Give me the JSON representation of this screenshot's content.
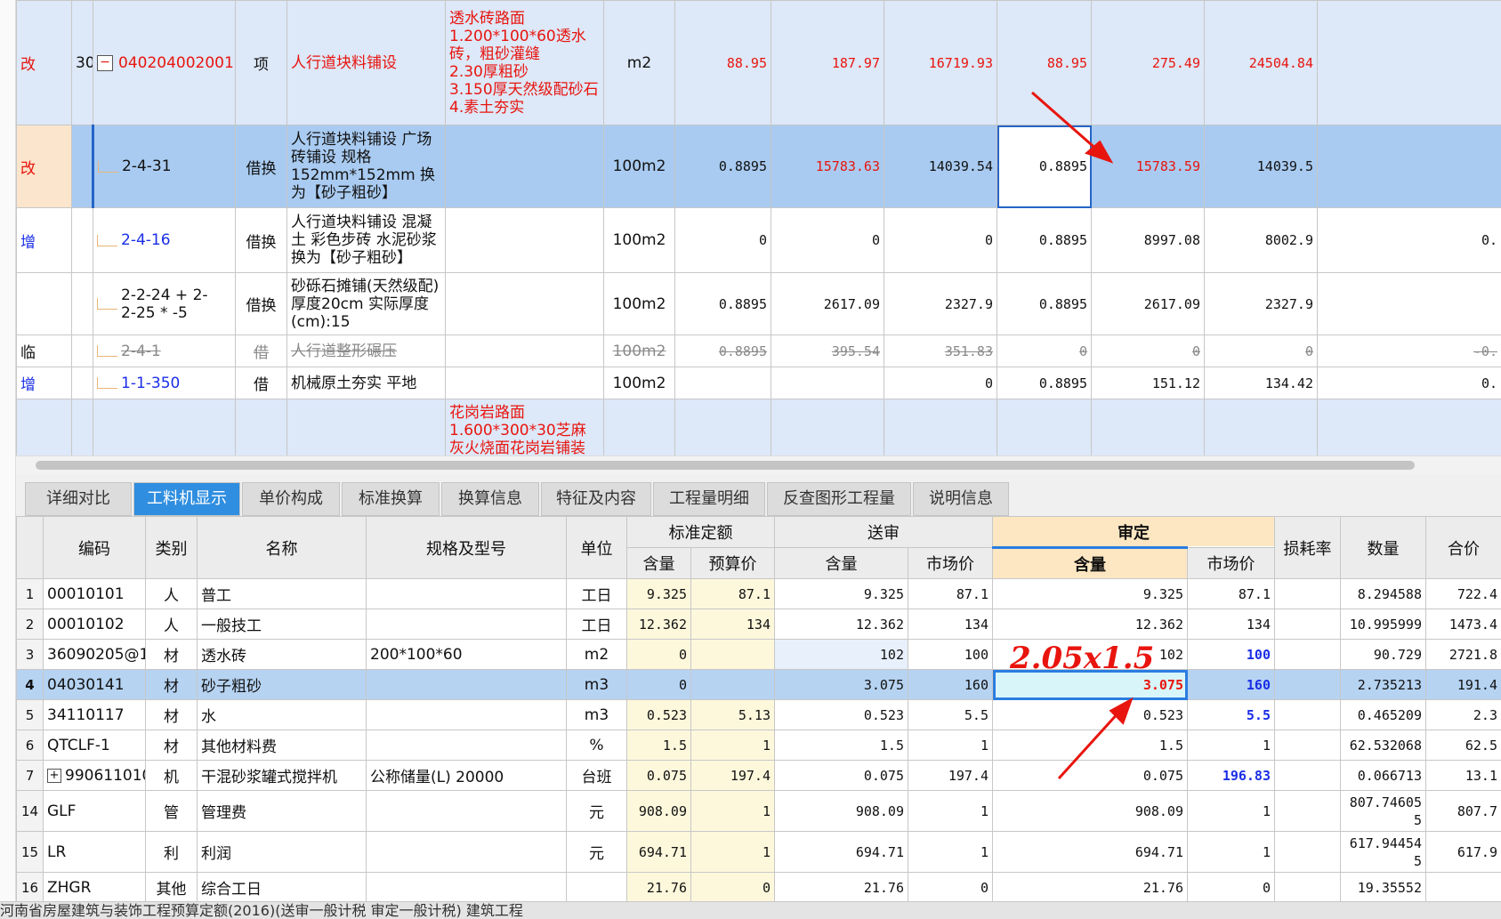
{
  "top_rows": [
    {
      "flag": "改",
      "flag_color": "red",
      "no": "30",
      "code": "040204002001",
      "code_color": "red",
      "type": "项",
      "name": "人行道块料铺设",
      "name_color": "red",
      "feature": "透水砖路面\n1.200*100*60透水砖，粗砂灌缝\n2.30厚粗砂\n3.150厚天然级配砂石\n4.素土夯实",
      "unit": "m2",
      "c1": "88.95",
      "c2": "187.97",
      "c3": "16719.93",
      "c4": "88.95",
      "c5": "275.49",
      "c6": "24504.84",
      "c7": ""
    },
    {
      "flag": "改",
      "flag_color": "red",
      "no": "",
      "code": "2-4-31",
      "code_color": "black",
      "type": "借换",
      "name": "人行道块料铺设 广场砖铺设 规格152mm*152mm 换为【砂子粗砂】",
      "name_color": "black",
      "feature": "",
      "unit": "100m2",
      "c1": "0.8895",
      "c2": "15783.63",
      "c3": "14039.54",
      "c4": "0.8895",
      "c5": "15783.59",
      "c6": "14039.5",
      "c7": ""
    },
    {
      "flag": "增",
      "flag_color": "blue",
      "no": "",
      "code": "2-4-16",
      "code_color": "blue",
      "type": "借换",
      "name": "人行道块料铺设 混凝土 彩色步砖 水泥砂浆 换为【砂子粗砂】",
      "name_color": "black",
      "feature": "",
      "unit": "100m2",
      "c1": "0",
      "c2": "0",
      "c3": "0",
      "c4": "0.8895",
      "c5": "8997.08",
      "c6": "8002.9",
      "c7": "0."
    },
    {
      "flag": "",
      "flag_color": "black",
      "no": "",
      "code": "2-2-24 + 2-2-25 * -5",
      "code_color": "black",
      "type": "借换",
      "name": "砂砾石摊铺(天然级配)厚度20cm 实际厚度(cm):15",
      "name_color": "black",
      "feature": "",
      "unit": "100m2",
      "c1": "0.8895",
      "c2": "2617.09",
      "c3": "2327.9",
      "c4": "0.8895",
      "c5": "2617.09",
      "c6": "2327.9",
      "c7": ""
    },
    {
      "flag": "临",
      "flag_color": "black",
      "no": "",
      "code": "2-4-1",
      "code_color": "gray",
      "type": "借",
      "name": "人行道整形碾压",
      "name_color": "gray",
      "feature": "",
      "unit": "100m2",
      "c1": "0.8895",
      "c2": "395.54",
      "c3": "351.83",
      "c4": "0",
      "c5": "0",
      "c6": "0",
      "c7": "-0."
    },
    {
      "flag": "增",
      "flag_color": "blue",
      "no": "",
      "code": "1-1-350",
      "code_color": "blue",
      "type": "借",
      "name": "机械原土夯实 平地",
      "name_color": "black",
      "feature": "",
      "unit": "100m2",
      "c1": "",
      "c2": "",
      "c3": "0",
      "c4": "0.8895",
      "c5": "151.12",
      "c6": "134.42",
      "c7": "0."
    },
    {
      "flag": "",
      "flag_color": "black",
      "no": "",
      "code": "",
      "code_color": "black",
      "type": "",
      "name": "",
      "name_color": "black",
      "feature": "花岗岩路面\n1.600*300*30芝麻灰火烧面花岗岩铺装",
      "unit": "",
      "c1": "",
      "c2": "",
      "c3": "",
      "c4": "",
      "c5": "",
      "c6": "",
      "c7": ""
    }
  ],
  "tabs": [
    "详细对比",
    "工料机显示",
    "单价构成",
    "标准换算",
    "换算信息",
    "特征及内容",
    "工程量明细",
    "反查图形工程量",
    "说明信息"
  ],
  "active_tab": "工料机显示",
  "headers": {
    "code": "编码",
    "type": "类别",
    "name": "名称",
    "spec": "规格及型号",
    "unit": "单位",
    "std": "标准定额",
    "std_qty": "含量",
    "std_price": "预算价",
    "sub": "送审",
    "sub_qty": "含量",
    "sub_price": "市场价",
    "aud": "审定",
    "aud_qty": "含量",
    "aud_price": "市场价",
    "loss": "损耗率",
    "amount": "数量",
    "total": "合价"
  },
  "bottom_rows": [
    {
      "rn": "1",
      "code": "00010101",
      "type": "人",
      "name": "普工",
      "spec": "",
      "unit": "工日",
      "sq": "9.325",
      "sp": "87.1",
      "bq": "9.325",
      "bp": "87.1",
      "aq": "9.325",
      "ap": "87.1",
      "loss": "",
      "amt": "8.294588",
      "tot": "722.4"
    },
    {
      "rn": "2",
      "code": "00010102",
      "type": "人",
      "name": "一般技工",
      "spec": "",
      "unit": "工日",
      "sq": "12.362",
      "sp": "134",
      "bq": "12.362",
      "bp": "134",
      "aq": "12.362",
      "ap": "134",
      "loss": "",
      "amt": "10.995999",
      "tot": "1473.4"
    },
    {
      "rn": "3",
      "code": "36090205@1",
      "type": "材",
      "name": "透水砖",
      "spec": "200*100*60",
      "unit": "m2",
      "sq": "0",
      "sp": "",
      "bq": "102",
      "bp": "100",
      "aq": "102",
      "ap": "100",
      "loss": "",
      "amt": "90.729",
      "tot": "2721.8"
    },
    {
      "rn": "4",
      "code": "04030141",
      "type": "材",
      "name": "砂子粗砂",
      "spec": "",
      "unit": "m3",
      "sq": "0",
      "sp": "",
      "bq": "3.075",
      "bp": "160",
      "aq": "3.075",
      "ap": "160",
      "loss": "",
      "amt": "2.735213",
      "tot": "191.4"
    },
    {
      "rn": "5",
      "code": "34110117",
      "type": "材",
      "name": "水",
      "spec": "",
      "unit": "m3",
      "sq": "0.523",
      "sp": "5.13",
      "bq": "0.523",
      "bp": "5.5",
      "aq": "0.523",
      "ap": "5.5",
      "loss": "",
      "amt": "0.465209",
      "tot": "2.3"
    },
    {
      "rn": "6",
      "code": "QTCLF-1",
      "type": "材",
      "name": "其他材料费",
      "spec": "",
      "unit": "%",
      "sq": "1.5",
      "sp": "1",
      "bq": "1.5",
      "bp": "1",
      "aq": "1.5",
      "ap": "1",
      "loss": "",
      "amt": "62.532068",
      "tot": "62.5"
    },
    {
      "rn": "7",
      "code": "990611010",
      "type": "机",
      "name": "干混砂浆罐式搅拌机",
      "spec": "公称储量(L) 20000",
      "unit": "台班",
      "sq": "0.075",
      "sp": "197.4",
      "bq": "0.075",
      "bp": "197.4",
      "aq": "0.075",
      "ap": "196.83",
      "loss": "",
      "amt": "0.066713",
      "tot": "13.1"
    },
    {
      "rn": "14",
      "code": "GLF",
      "type": "管",
      "name": "管理费",
      "spec": "",
      "unit": "元",
      "sq": "908.09",
      "sp": "1",
      "bq": "908.09",
      "bp": "1",
      "aq": "908.09",
      "ap": "1",
      "loss": "",
      "amt": "807.74605\n5",
      "tot": "807.7"
    },
    {
      "rn": "15",
      "code": "LR",
      "type": "利",
      "name": "利润",
      "spec": "",
      "unit": "元",
      "sq": "694.71",
      "sp": "1",
      "bq": "694.71",
      "bp": "1",
      "aq": "694.71",
      "ap": "1",
      "loss": "",
      "amt": "617.94454\n5",
      "tot": "617.9"
    },
    {
      "rn": "16",
      "code": "ZHGR",
      "type": "其他",
      "name": "综合工日",
      "spec": "",
      "unit": "",
      "sq": "21.76",
      "sp": "0",
      "bq": "21.76",
      "bp": "0",
      "aq": "21.76",
      "ap": "0",
      "loss": "",
      "amt": "19.35552",
      "tot": ""
    }
  ],
  "annotation": "2.05x1.5",
  "status": "河南省房屋建筑与装饰工程预算定额(2016)(送审一般计税 审定一般计税)      建筑工程"
}
